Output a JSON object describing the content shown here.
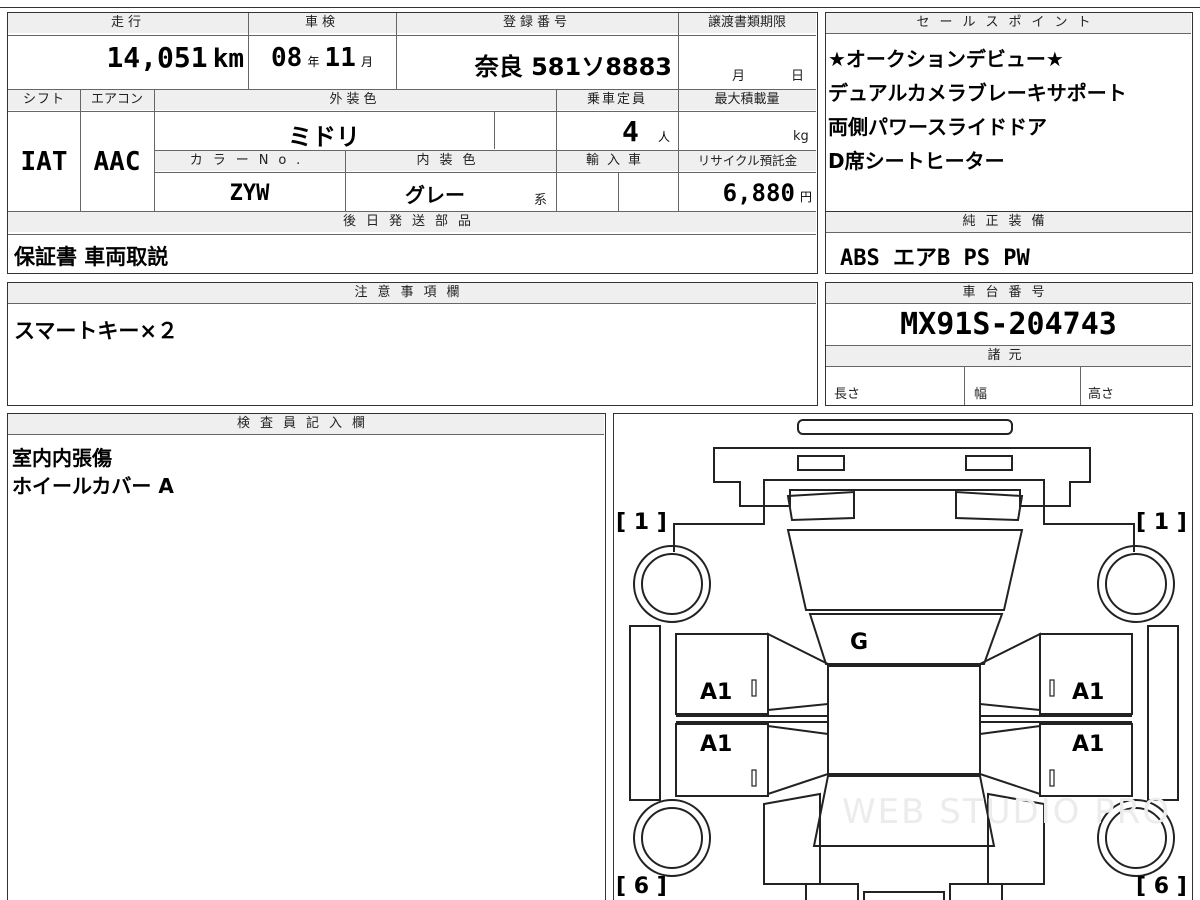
{
  "top": {
    "mileage_label": "走行",
    "mileage_value": "14,051",
    "mileage_unit": "km",
    "inspection_label": "車検",
    "inspection_year": "08",
    "inspection_year_unit": "年",
    "inspection_month": "11",
    "inspection_month_unit": "月",
    "reg_label": "登録番号",
    "reg_value": "奈良 581ソ8883",
    "transfer_label": "譲渡書類期限",
    "transfer_month_unit": "月",
    "transfer_day_unit": "日"
  },
  "row2": {
    "shift_label": "シフト",
    "shift_value": "IAT",
    "aircon_label": "エアコン",
    "aircon_value": "AAC",
    "exterior_label": "外装色",
    "exterior_value": "ミドリ",
    "capacity_label": "乗車定員",
    "capacity_value": "4",
    "capacity_unit": "人",
    "max_load_label": "最大積載量",
    "max_load_unit": "kg",
    "color_no_label": "カラーNo.",
    "color_no_value": "ZYW",
    "interior_label": "内装色",
    "interior_value": "グレー",
    "interior_suffix": "系",
    "import_label": "輸入車",
    "recycle_label": "リサイクル預託金",
    "recycle_value": "6,880",
    "recycle_unit": "円"
  },
  "later_parts": {
    "label": "後日発送部品",
    "value": "保証書 車両取説"
  },
  "sales_points": {
    "label": "セールスポイント",
    "items": [
      "★オークションデビュー★",
      "デュアルカメラブレーキサポート",
      "両側パワースライドドア",
      "D席シートヒーター"
    ]
  },
  "genuine_equipment": {
    "label": "純正装備",
    "value": "ABS エアB PS PW"
  },
  "notes": {
    "label": "注意事項欄",
    "value": "スマートキー×２"
  },
  "chassis": {
    "label": "車台番号",
    "value": "MX91S-204743",
    "specs_label": "諸元",
    "length_label": "長さ",
    "width_label": "幅",
    "height_label": "高さ"
  },
  "inspector": {
    "label": "検査員記入欄",
    "lines": [
      "室内内張傷",
      "ホイールカバー A"
    ]
  },
  "diagram": {
    "tire_front_left": "1",
    "tire_front_right": "1",
    "tire_rear_left": "6",
    "tire_rear_right": "6",
    "mark_glass": "G",
    "mark_left_front_door": "A1",
    "mark_right_front_door": "A1",
    "mark_left_rear_door": "A1",
    "mark_right_rear_door": "A1",
    "watermark": "WEB STUDIO PRO"
  }
}
